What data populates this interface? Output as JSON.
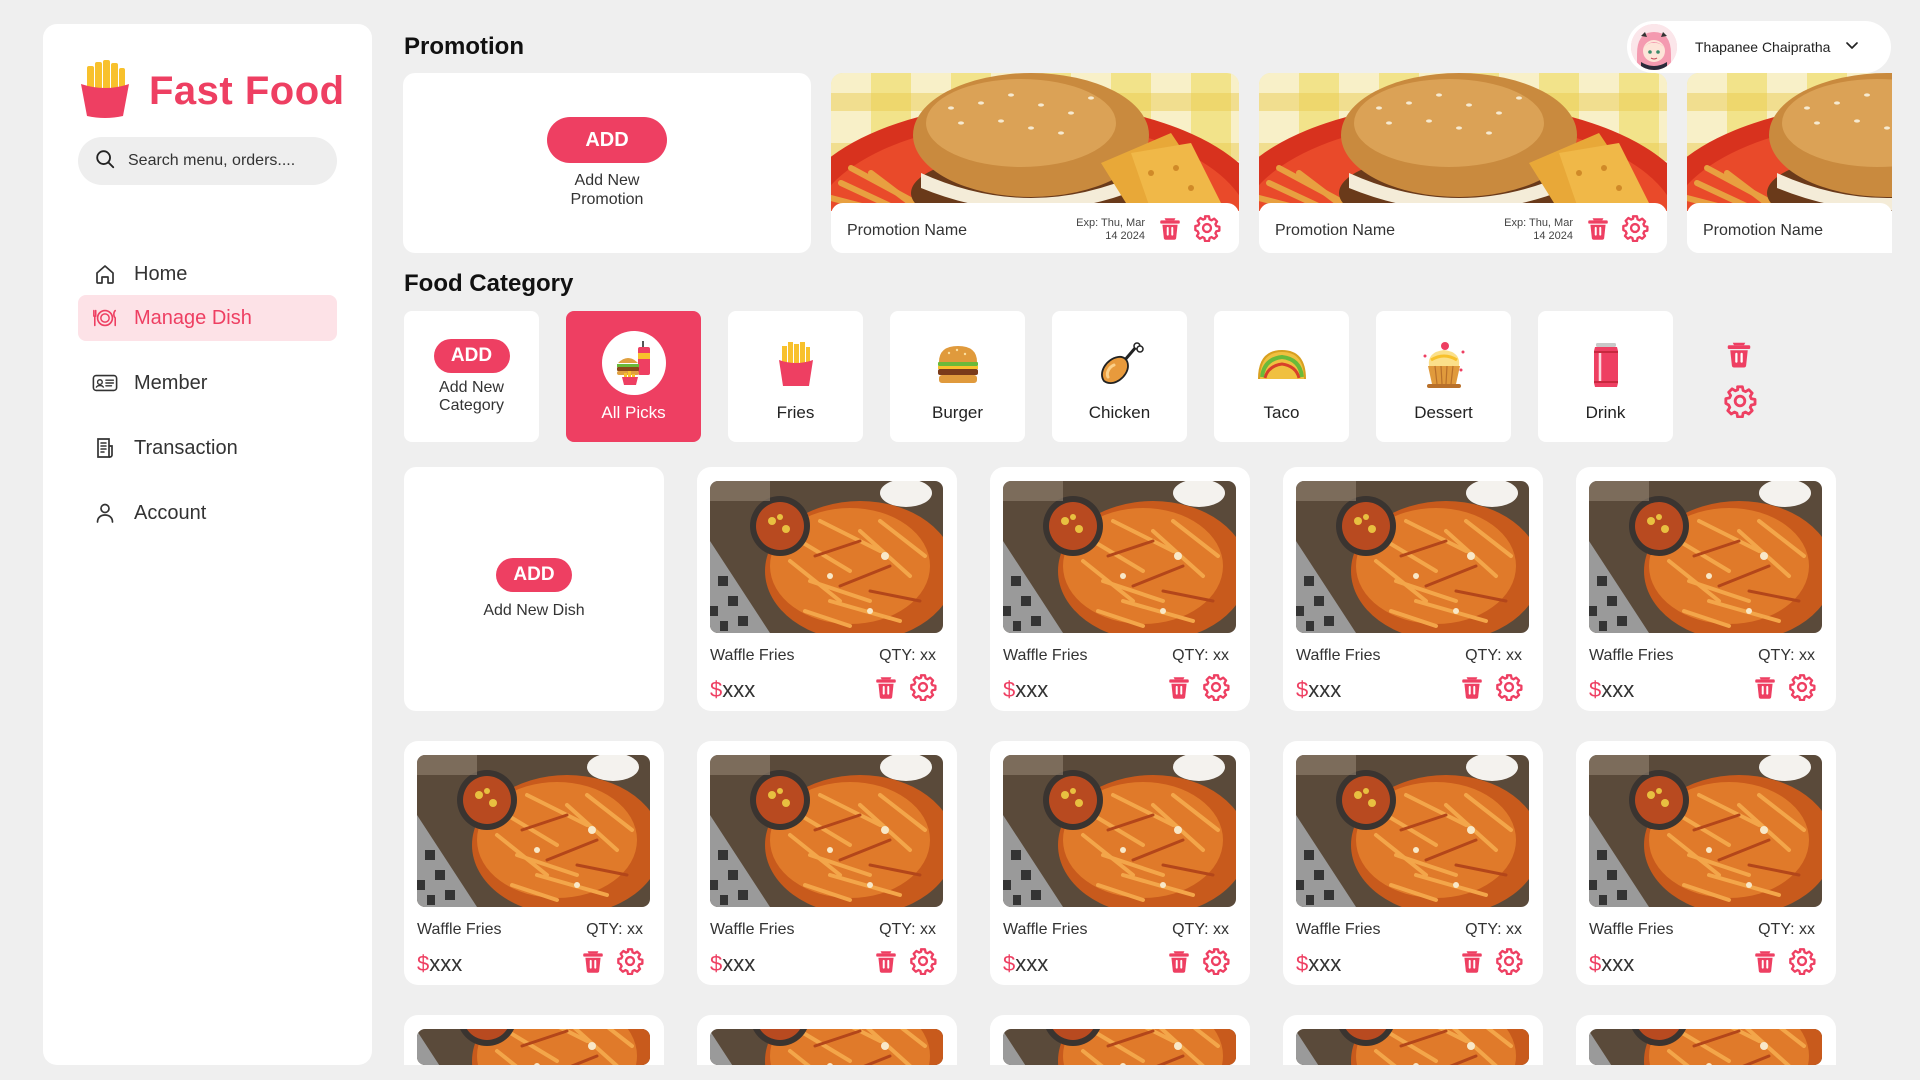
{
  "brand": {
    "name": "Fast Food",
    "accent": "#ee3f62"
  },
  "search": {
    "placeholder": "Search menu, orders...."
  },
  "nav": [
    {
      "label": "Home",
      "icon": "home-icon"
    },
    {
      "label": "Manage Dish",
      "icon": "dish-icon",
      "active": true
    },
    {
      "label": "Member",
      "icon": "member-card-icon"
    },
    {
      "label": "Transaction",
      "icon": "receipt-icon"
    },
    {
      "label": "Account",
      "icon": "user-icon"
    }
  ],
  "user": {
    "name": "Thapanee Chaipratha"
  },
  "promotion": {
    "title": "Promotion",
    "add_label": "ADD",
    "add_sub": "Add New Promotion",
    "cards": [
      {
        "name": "Promotion Name",
        "exp_line1": "Exp: Thu, Mar",
        "exp_line2": "14 2024"
      },
      {
        "name": "Promotion Name",
        "exp_line1": "Exp: Thu, Mar",
        "exp_line2": "14 2024"
      },
      {
        "name": "Promotion Name",
        "exp_line1": "",
        "exp_line2": ""
      }
    ]
  },
  "category": {
    "title": "Food Category",
    "add_label": "ADD",
    "add_sub": "Add New Category",
    "items": [
      {
        "label": "All Picks",
        "icon": "combo-meal-icon",
        "active": true
      },
      {
        "label": "Fries",
        "icon": "fries-icon"
      },
      {
        "label": "Burger",
        "icon": "burger-icon"
      },
      {
        "label": "Chicken",
        "icon": "chicken-leg-icon"
      },
      {
        "label": "Taco",
        "icon": "taco-icon"
      },
      {
        "label": "Dessert",
        "icon": "cupcake-icon"
      },
      {
        "label": "Drink",
        "icon": "soda-can-icon"
      }
    ]
  },
  "dishes": {
    "add_label": "ADD",
    "add_sub": "Add New Dish",
    "items": [
      {
        "name": "Waffle Fries",
        "qty": "QTY: xx",
        "currency": "$",
        "price": "xxx"
      },
      {
        "name": "Waffle Fries",
        "qty": "QTY: xx",
        "currency": "$",
        "price": "xxx"
      },
      {
        "name": "Waffle Fries",
        "qty": "QTY: xx",
        "currency": "$",
        "price": "xxx"
      },
      {
        "name": "Waffle Fries",
        "qty": "QTY: xx",
        "currency": "$",
        "price": "xxx"
      },
      {
        "name": "Waffle Fries",
        "qty": "QTY: xx",
        "currency": "$",
        "price": "xxx"
      },
      {
        "name": "Waffle Fries",
        "qty": "QTY: xx",
        "currency": "$",
        "price": "xxx"
      },
      {
        "name": "Waffle Fries",
        "qty": "QTY: xx",
        "currency": "$",
        "price": "xxx"
      },
      {
        "name": "Waffle Fries",
        "qty": "QTY: xx",
        "currency": "$",
        "price": "xxx"
      },
      {
        "name": "Waffle Fries",
        "qty": "QTY: xx",
        "currency": "$",
        "price": "xxx"
      }
    ]
  }
}
